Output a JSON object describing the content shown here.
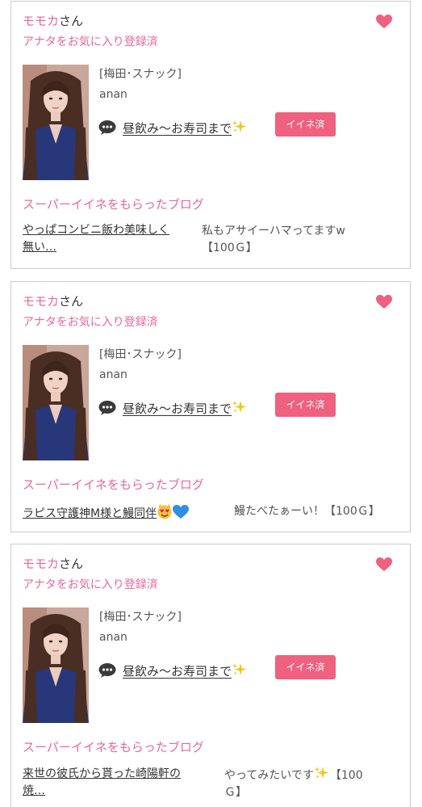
{
  "cards": [
    {
      "name": "モモカ",
      "name_suffix": "さん",
      "fav_status": "アナタをお気に入り登録済",
      "category": "[梅田･スナック]",
      "cast_name": "anan",
      "blog_title": "昼飲み〜お寿司まで",
      "iine_button": "イイネ済",
      "super_label": "スーパーイイネをもらったブログ",
      "sub_blog_line1": "やっぱコンビニ飯わ美味しく",
      "sub_blog_line2": "無い…",
      "comment_line1": "私もアサイーハマってますw",
      "comment_line2": "【100Ｇ】"
    },
    {
      "name": "モモカ",
      "name_suffix": "さん",
      "fav_status": "アナタをお気に入り登録済",
      "category": "[梅田･スナック]",
      "cast_name": "anan",
      "blog_title": "昼飲み〜お寿司まで",
      "iine_button": "イイネ済",
      "super_label": "スーパーイイネをもらったブログ",
      "sub_blog_line1": "ラピス守護神M様と鰻同伴",
      "comment_line1": "鰻たべたぁーい！【100Ｇ】"
    },
    {
      "name": "モモカ",
      "name_suffix": "さん",
      "fav_status": "アナタをお気に入り登録済",
      "category": "[梅田･スナック]",
      "cast_name": "anan",
      "blog_title": "昼飲み〜お寿司まで",
      "iine_button": "イイネ済",
      "super_label": "スーパーイイネをもらったブログ",
      "sub_blog_line1": "来世の彼氏から貰った崎陽軒の",
      "sub_blog_line2": "焼…",
      "comment_line1": "やってみたいです",
      "comment_line1_end": "【100",
      "comment_line2": "Ｇ】"
    }
  ],
  "icons": {
    "heart": "heart-icon",
    "bubble": "speech-bubble-icon",
    "sparkle": "sparkles-emoji",
    "emoji_face": "heart-eyes-cat-emoji",
    "emoji_heart": "blue-heart-emoji"
  },
  "colors": {
    "accent_pink": "#e8679a",
    "button": "#f0607f",
    "heart": "#f0607f",
    "border": "#cccccc"
  }
}
